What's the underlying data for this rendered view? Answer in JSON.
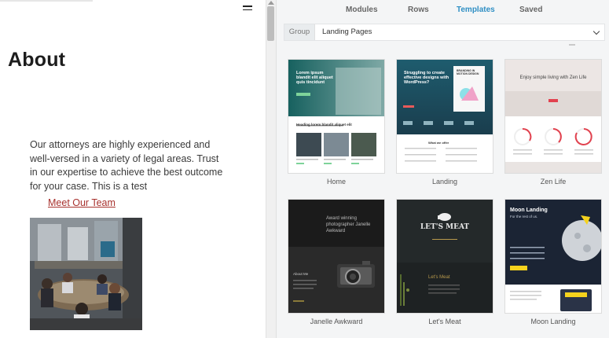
{
  "preview": {
    "heading": "About",
    "body": "Our attorneys are highly experienced and well-versed in a variety of legal areas. Trust in our expertise to achieve the best outcome for your case. This is a test",
    "link": "Meet Our Team"
  },
  "panel": {
    "tabs": [
      "Modules",
      "Rows",
      "Templates",
      "Saved"
    ],
    "active_tab": "Templates",
    "group_label": "Group",
    "group_value": "Landing Pages",
    "templates": [
      "Home",
      "Landing",
      "Zen Life",
      "Janelle Awkward",
      "Let's Meat",
      "Moon Landing"
    ]
  },
  "thumbs": {
    "home_title": "Lorem ipsum blandit elit aliquet quis tincidunt",
    "home_sub": "Heading lorem blandit aliquet elit",
    "landing_title": "Struggling to create effective designs with WordPress?",
    "landing_card": "BRANDING IN MOTION DESIGN",
    "landing_sub": "What we offer",
    "zen_title": "Enjoy simple living with Zen Life",
    "janelle_title": "Award winning photographer Janelle Awkward",
    "janelle_sub": "About Me",
    "meat_title": "LET'S MEAT",
    "meat_sub": "Let's Meat",
    "moon_title": "Moon Landing",
    "moon_sub": "For the rest of us."
  },
  "colors": {
    "accent": "#2f8fc4",
    "link": "#a8322e",
    "zen_red": "#e2424f",
    "teal": "#1f6b74",
    "meat_gold": "#b99a4c",
    "moon_navy": "#1b2434",
    "moon_yellow": "#f5d21d"
  },
  "icons": [
    "hamburger-menu-icon",
    "chevron-down-icon",
    "scroll-up-arrow-icon"
  ]
}
